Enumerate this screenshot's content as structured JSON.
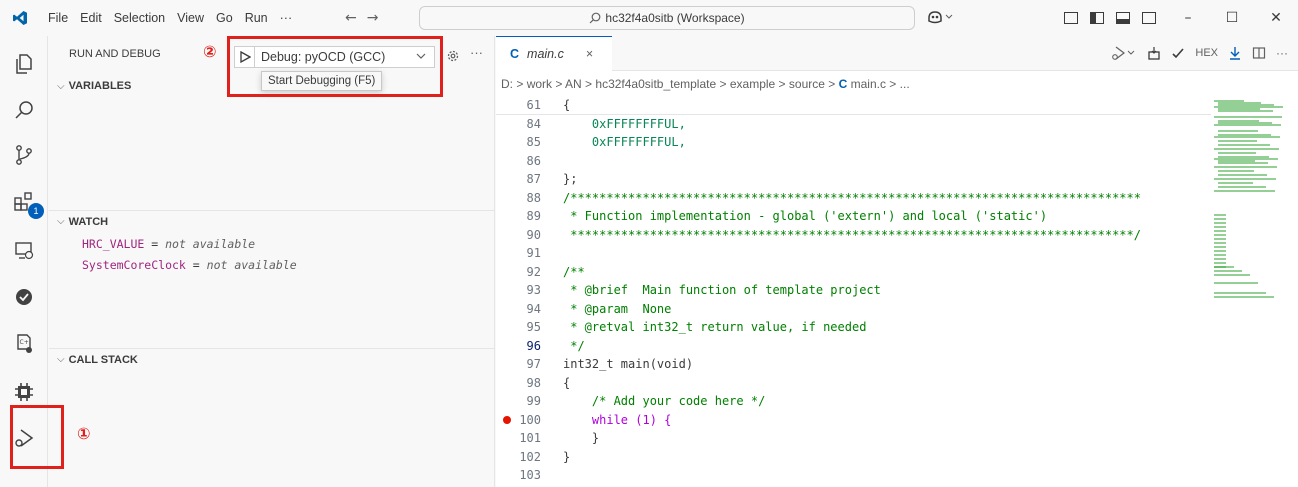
{
  "titlebar": {
    "menu": [
      "File",
      "Edit",
      "Selection",
      "View",
      "Go",
      "Run",
      "···"
    ],
    "search_text": "hc32f4a0sitb (Workspace)",
    "copilot_chevron": "⌄",
    "window_controls": [
      "–",
      "☐",
      "✕"
    ]
  },
  "activity_bar": {
    "items": [
      "explorer-icon",
      "search-icon",
      "source-control-icon",
      "extensions-icon",
      "remote-explorer-icon",
      "testing-icon",
      "debug-console-icon",
      "chip-icon",
      "run-and-debug-icon"
    ],
    "extensions_badge": "1"
  },
  "sidebar": {
    "title": "RUN AND DEBUG",
    "launch_config": "Debug: pyOCD (GCC)",
    "tooltip": "Start Debugging (F5)",
    "more": "···",
    "sections": {
      "variables": "VARIABLES",
      "watch": "WATCH",
      "call_stack": "CALL STACK"
    },
    "watch_items": [
      {
        "name": "HRC_VALUE",
        "eq": " = ",
        "value": "not available"
      },
      {
        "name": "SystemCoreClock",
        "eq": " = ",
        "value": "not available"
      }
    ]
  },
  "annotations": {
    "marker_1": "①",
    "marker_2": "②",
    "color": "#e0201a"
  },
  "editor": {
    "tab": {
      "lang": "C",
      "name": "main.c",
      "close": "×"
    },
    "toolbar": {
      "hex": "HEX",
      "more": "···"
    },
    "breadcrumb": [
      "D:",
      "work",
      "AN",
      "hc32f4a0sitb_template",
      "example",
      "source"
    ],
    "breadcrumb_file": "main.c",
    "breadcrumb_tail": "...",
    "sticky_line": {
      "num": "61",
      "text": "{"
    },
    "lines": [
      {
        "num": "84",
        "text": "    0xFFFFFFFFUL,"
      },
      {
        "num": "85",
        "text": "    0xFFFFFFFFUL,"
      },
      {
        "num": "86",
        "text": ""
      },
      {
        "num": "87",
        "text": "};"
      },
      {
        "num": "88",
        "text": "/*******************************************************************************"
      },
      {
        "num": "89",
        "text": " * Function implementation - global ('extern') and local ('static')"
      },
      {
        "num": "90",
        "text": " ******************************************************************************/"
      },
      {
        "num": "91",
        "text": ""
      },
      {
        "num": "92",
        "text": "/**"
      },
      {
        "num": "93",
        "text": " * @brief  Main function of template project"
      },
      {
        "num": "94",
        "text": " * @param  None"
      },
      {
        "num": "95",
        "text": " * @retval int32_t return value, if needed"
      },
      {
        "num": "96",
        "text": " */"
      },
      {
        "num": "97",
        "text": "int32_t main(void)"
      },
      {
        "num": "98",
        "text": "{"
      },
      {
        "num": "99",
        "text": "    /* Add your code here */"
      },
      {
        "num": "100",
        "text": "    while (1) {"
      },
      {
        "num": "101",
        "text": "    }"
      },
      {
        "num": "102",
        "text": "}"
      },
      {
        "num": "103",
        "text": ""
      }
    ],
    "current_line": "96",
    "breakpoint_line": "100"
  }
}
